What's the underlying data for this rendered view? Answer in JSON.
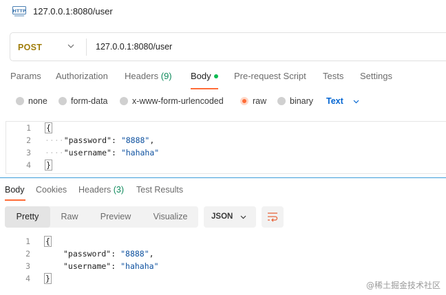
{
  "window": {
    "title": "127.0.0.1:8080/user",
    "icon": "http-icon"
  },
  "request": {
    "method": "POST",
    "url": "127.0.0.1:8080/user"
  },
  "request_tabs": [
    {
      "label": "Params"
    },
    {
      "label": "Authorization"
    },
    {
      "label": "Headers ",
      "count": "(9)"
    },
    {
      "label": "Body",
      "active": true,
      "indicator": "green-dot"
    },
    {
      "label": "Pre-request Script"
    },
    {
      "label": "Tests"
    },
    {
      "label": "Settings"
    }
  ],
  "body_types": [
    {
      "label": "none"
    },
    {
      "label": "form-data"
    },
    {
      "label": "x-www-form-urlencoded"
    },
    {
      "label": "raw",
      "selected": true
    },
    {
      "label": "binary"
    }
  ],
  "raw_format": "Text",
  "request_body": {
    "line_numbers": [
      "1",
      "2",
      "3",
      "4"
    ],
    "line1": "{",
    "line2_key": "\"password\"",
    "line2_sep": ": ",
    "line2_val": "\"8888\"",
    "line2_end": ",",
    "line3_key": "\"username\"",
    "line3_sep": ": ",
    "line3_val": "\"hahaha\"",
    "line4": "}",
    "indent_dots": "····"
  },
  "response_tabs": [
    {
      "label": "Body",
      "active": true
    },
    {
      "label": "Cookies"
    },
    {
      "label": "Headers ",
      "count": "(3)"
    },
    {
      "label": "Test Results"
    }
  ],
  "view_modes": [
    {
      "label": "Pretty",
      "active": true
    },
    {
      "label": "Raw"
    },
    {
      "label": "Preview"
    },
    {
      "label": "Visualize"
    }
  ],
  "response_format": "JSON",
  "response_body": {
    "line_numbers": [
      "1",
      "2",
      "3",
      "4"
    ],
    "line1": "{",
    "line2_key": "\"password\"",
    "line2_sep": ": ",
    "line2_val": "\"8888\"",
    "line2_end": ",",
    "line3_key": "\"username\"",
    "line3_sep": ": ",
    "line3_val": "\"hahaha\"",
    "line4": "}"
  },
  "watermark": "@稀土掘金技术社区",
  "colors": {
    "accent": "#ff6c37",
    "method": "#a07d0a",
    "link": "#0265d2",
    "count": "#0f8a5c",
    "string": "#0b4f9e"
  }
}
